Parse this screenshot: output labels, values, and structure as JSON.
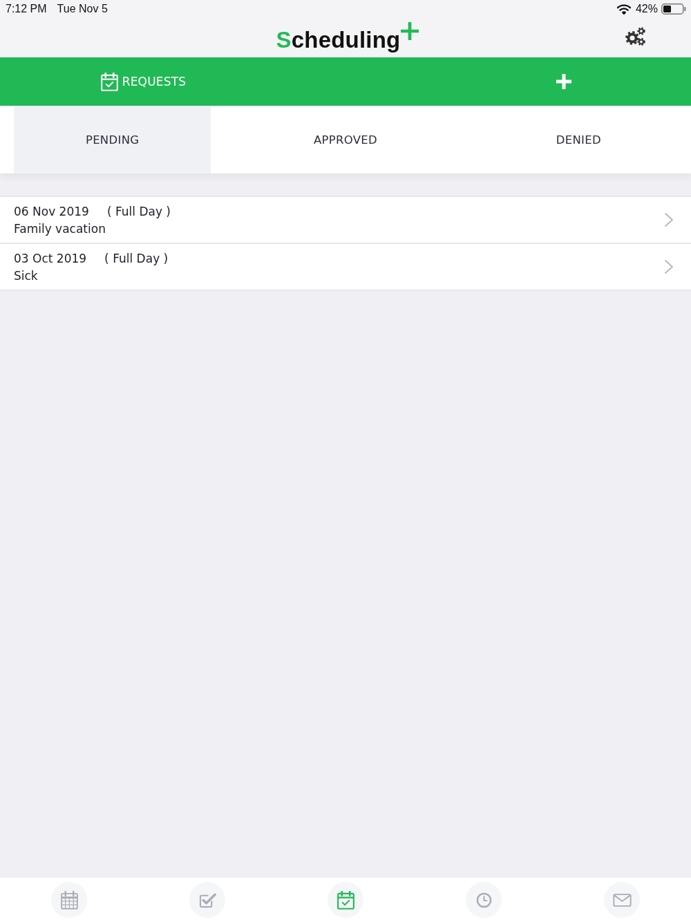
{
  "status_bar": {
    "time": "7:12 PM",
    "date": "Tue Nov 5",
    "battery": "42%"
  },
  "header": {
    "logo": "Scheduling"
  },
  "action_bar": {
    "requests_button": {
      "label": "REQUESTS"
    }
  },
  "tabs": [
    {
      "label": "PENDING",
      "selected": true
    },
    {
      "label": "APPROVED",
      "selected": false
    },
    {
      "label": "DENIED",
      "selected": false
    }
  ],
  "requests": [
    {
      "date": "06 Nov 2019",
      "duration": "( Full Day )",
      "reason": "Family vacation"
    },
    {
      "date": "03 Oct 2019",
      "duration": "( Full Day )",
      "reason": "Sick"
    }
  ],
  "bottom_nav": [
    {
      "kind": "calendar",
      "selected": false
    },
    {
      "kind": "tasks",
      "selected": false
    },
    {
      "kind": "requests",
      "selected": true
    },
    {
      "kind": "clock",
      "selected": false
    },
    {
      "kind": "mail",
      "selected": false
    }
  ]
}
